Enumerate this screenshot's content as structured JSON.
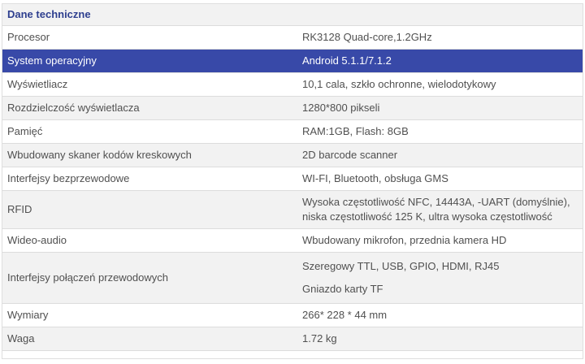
{
  "table": {
    "title": "Dane techniczne",
    "rows": [
      {
        "key": "Procesor",
        "value": "RK3128 Quad-core,1.2GHz"
      },
      {
        "key": "System operacyjny",
        "value": "Android 5.1.1/7.1.2"
      },
      {
        "key": "Wyświetliacz",
        "value": "10,1 cala, szkło ochronne, wielodotykowy"
      },
      {
        "key": "Rozdzielczość wyświetlacza",
        "value": "1280*800 pikseli"
      },
      {
        "key": "Pamięć",
        "value": "RAM:1GB, Flash: 8GB"
      },
      {
        "key": "Wbudowany skaner kodów kreskowych",
        "value": "2D barcode scanner"
      },
      {
        "key": "Interfejsy bezprzewodowe",
        "value": "WI-FI, Bluetooth, obsługa GMS"
      },
      {
        "key": "RFID",
        "value": "Wysoka częstotliwość NFC, 14443A, -UART (domyślnie), niska częstotliwość 125 K, ultra wysoka częstotliwość"
      },
      {
        "key": "Wideo-audio",
        "value": "Wbudowany mikrofon, przednia kamera HD"
      },
      {
        "key": "Interfejsy połączeń przewodowych",
        "value_lines": [
          "Szeregowy TTL, USB, GPIO, HDMI, RJ45",
          "Gniazdo karty TF"
        ]
      },
      {
        "key": "Wymiary",
        "value": "266* 228 * 44 mm"
      },
      {
        "key": "Waga",
        "value": "1.72 kg"
      }
    ],
    "highlighted_row": "System operacyjny",
    "colors": {
      "title_text": "#2e3f8f",
      "highlight_bg": "#3849a8",
      "highlight_text": "#ffffff",
      "stripe_bg": "#f2f2f2",
      "text": "#505050"
    }
  }
}
